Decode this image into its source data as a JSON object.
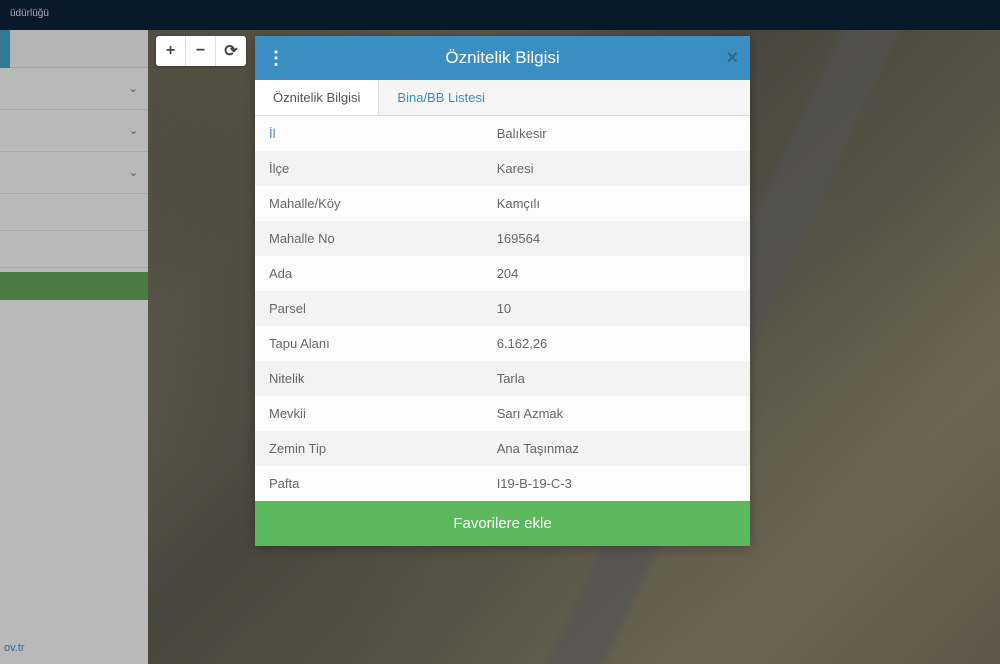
{
  "header": {
    "text": "üdürlüğü"
  },
  "sidebar": {
    "link": "ov.tr"
  },
  "map_controls": {
    "zoom_in": "+",
    "zoom_out": "−",
    "refresh": "⟳"
  },
  "modal": {
    "title": "Öznitelik Bilgisi",
    "menu_icon": "⋮",
    "close_icon": "×",
    "tabs": [
      {
        "label": "Öznitelik Bilgisi",
        "active": true
      },
      {
        "label": "Bina/BB Listesi",
        "active": false
      }
    ],
    "attributes": [
      {
        "label": "İl",
        "value": "Balıkesir"
      },
      {
        "label": "İlçe",
        "value": "Karesi"
      },
      {
        "label": "Mahalle/Köy",
        "value": "Kamçılı"
      },
      {
        "label": "Mahalle No",
        "value": "169564"
      },
      {
        "label": "Ada",
        "value": "204"
      },
      {
        "label": "Parsel",
        "value": "10"
      },
      {
        "label": "Tapu Alanı",
        "value": "6.162,26"
      },
      {
        "label": "Nitelik",
        "value": "Tarla"
      },
      {
        "label": "Mevkii",
        "value": "Sarı Azmak"
      },
      {
        "label": "Zemin Tip",
        "value": "Ana Taşınmaz"
      },
      {
        "label": "Pafta",
        "value": "I19-B-19-C-3"
      }
    ],
    "footer_button": "Favorilere ekle"
  }
}
